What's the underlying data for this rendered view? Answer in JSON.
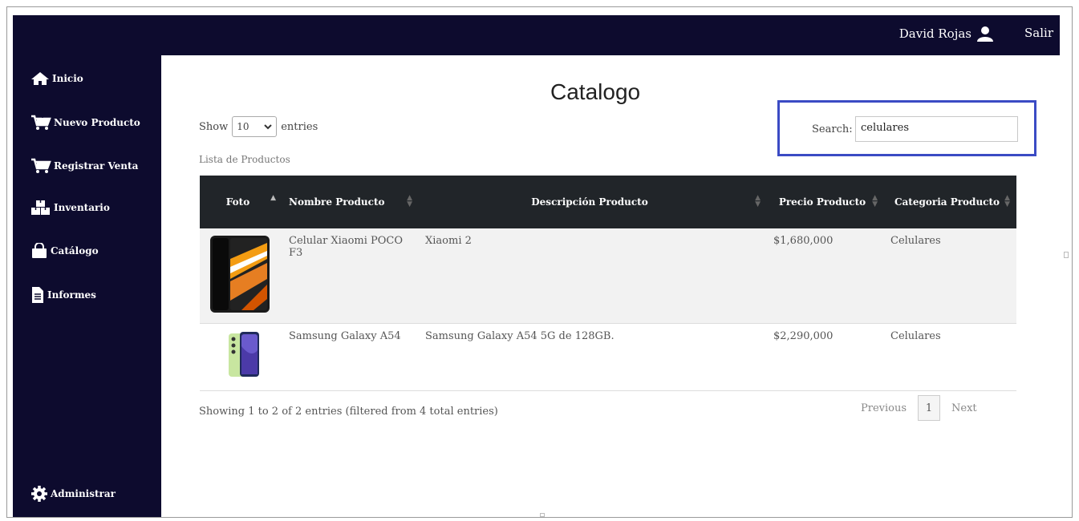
{
  "header": {
    "user_name": "David Rojas",
    "logout_label": "Salir"
  },
  "sidebar": {
    "items": [
      {
        "label": "Inicio",
        "icon": "home-icon"
      },
      {
        "label": "Nuevo Producto",
        "icon": "cart-add-icon"
      },
      {
        "label": "Registrar Venta",
        "icon": "cart-icon"
      },
      {
        "label": "Inventario",
        "icon": "boxes-icon"
      },
      {
        "label": "Catálogo",
        "icon": "shopping-bag-icon"
      },
      {
        "label": "Informes",
        "icon": "file-icon"
      }
    ],
    "admin": {
      "label": "Administrar",
      "icon": "gear-icon"
    }
  },
  "main": {
    "title": "Catalogo",
    "length": {
      "show_label": "Show",
      "value": "10",
      "entries_label": "entries"
    },
    "search": {
      "label": "Search:",
      "value": "celulares"
    },
    "caption": "Lista de Productos",
    "columns": [
      "Foto",
      "Nombre Producto",
      "Descripción Producto",
      "Precio Producto",
      "Categoria Producto"
    ],
    "rows": [
      {
        "name": "Celular Xiaomi POCO F3",
        "description": "Xiaomi 2",
        "price": "$1,680,000",
        "category": "Celulares"
      },
      {
        "name": "Samsung Galaxy A54",
        "description": "Samsung Galaxy A54 5G de 128GB.",
        "price": "$2,290,000",
        "category": "Celulares"
      }
    ],
    "info": "Showing 1 to 2 of 2 entries (filtered from 4 total entries)",
    "pagination": {
      "previous": "Previous",
      "current": "1",
      "next": "Next"
    }
  },
  "colors": {
    "sidebar_bg": "#0d0b2e",
    "table_header_bg": "#212529",
    "search_highlight": "#3b4bc4"
  }
}
